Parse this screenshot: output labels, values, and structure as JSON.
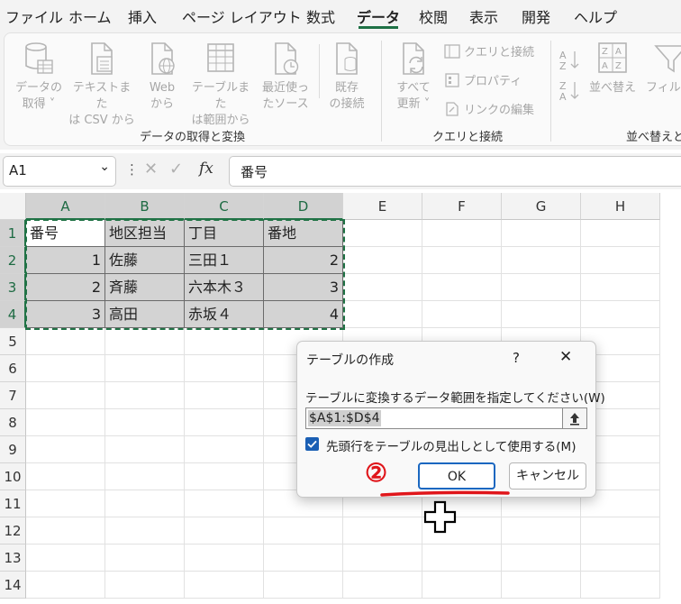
{
  "menu": {
    "tabs": [
      "ファイル",
      "ホーム",
      "挿入",
      "ページ レイアウト",
      "数式",
      "データ",
      "校閲",
      "表示",
      "開発",
      "ヘルプ"
    ],
    "active_tab": "データ"
  },
  "ribbon": {
    "get_data": {
      "line1": "データの",
      "line2": "取得 ˅"
    },
    "text_csv": {
      "line1": "テキストまた",
      "line2": "は CSV から"
    },
    "web": {
      "line1": "Web",
      "line2": "から"
    },
    "table_range": {
      "line1": "テーブルまた",
      "line2": "は範囲から"
    },
    "recent": {
      "line1": "最近使っ",
      "line2": "たソース"
    },
    "existing": {
      "line1": "既存",
      "line2": "の接続"
    },
    "group1_label": "データの取得と変換",
    "refresh_all": {
      "line1": "すべて",
      "line2": "更新 ˅"
    },
    "queries_connections": "クエリと接続",
    "properties": "プロパティ",
    "edit_links": "リンクの編集",
    "group2_label": "クエリと接続",
    "sort": "並べ替え",
    "filter": "フィル",
    "group3_label": "並べ替えと"
  },
  "formula_bar": {
    "name_box": "A1",
    "fx": "fx",
    "content": "番号"
  },
  "grid": {
    "columns": [
      "A",
      "B",
      "C",
      "D",
      "E",
      "F",
      "G",
      "H"
    ],
    "rows": [
      "1",
      "2",
      "3",
      "4",
      "5",
      "6",
      "7",
      "8",
      "9",
      "10",
      "11",
      "12",
      "13",
      "14"
    ],
    "cells": [
      [
        "番号",
        "地区担当",
        "丁目",
        "番地"
      ],
      [
        "1",
        "佐藤",
        "三田１",
        "2"
      ],
      [
        "2",
        "斉藤",
        "六本木３",
        "3"
      ],
      [
        "3",
        "高田",
        "赤坂４",
        "4"
      ]
    ]
  },
  "dialog": {
    "title": "テーブルの作成",
    "help": "?",
    "prompt": "テーブルに変換するデータ範囲を指定してください(W)",
    "range_value": "$A$1:$D$4",
    "checkbox_label": "先頭行をテーブルの見出しとして使用する(M)",
    "checkbox_checked": true,
    "ok_label": "OK",
    "cancel_label": "キャンセル"
  },
  "annotation": {
    "step_marker": "②",
    "marker_color": "#e0161b"
  },
  "colors": {
    "accent_green": "#217346",
    "selection_gray": "#d3d3d3",
    "ok_border": "#1a67c0",
    "checkbox_blue": "#1a5fb4"
  }
}
